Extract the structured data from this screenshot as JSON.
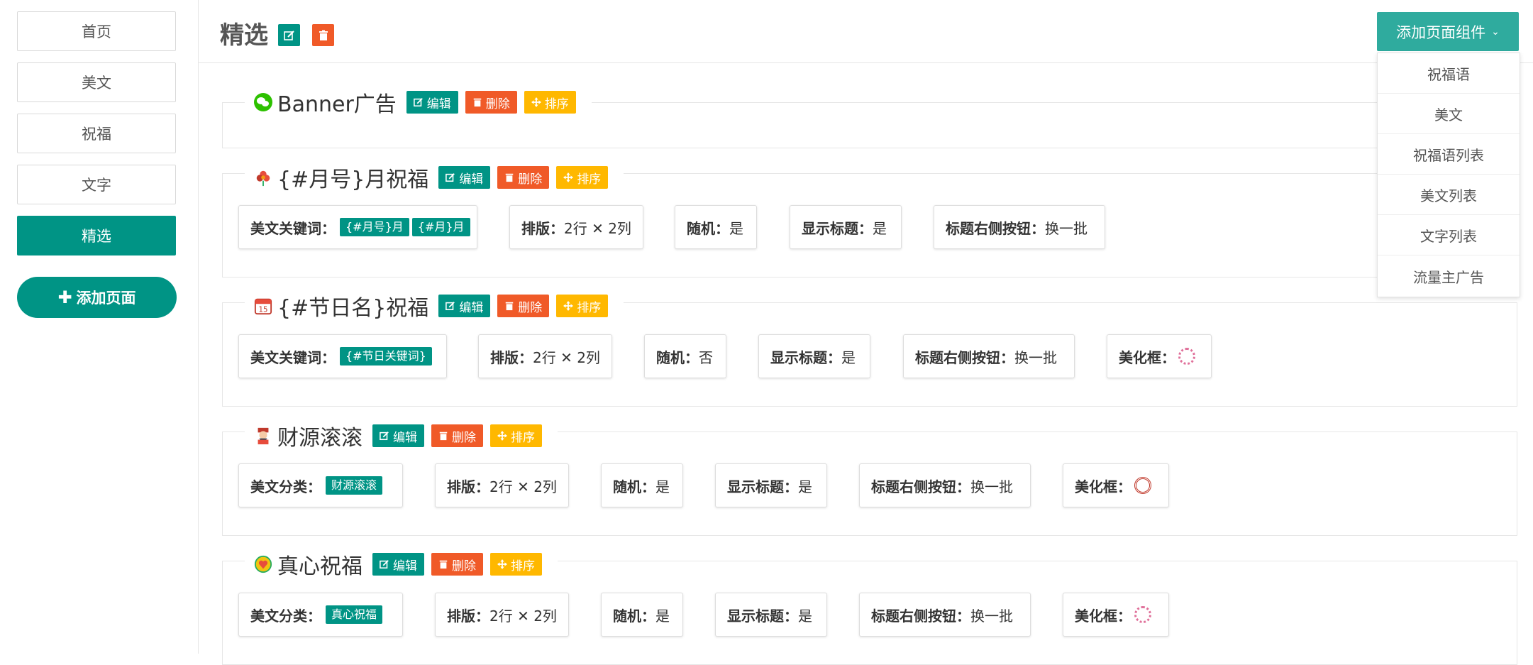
{
  "sidebar": {
    "items": [
      {
        "label": "首页"
      },
      {
        "label": "美文"
      },
      {
        "label": "祝福"
      },
      {
        "label": "文字"
      },
      {
        "label": "精选",
        "active": true
      }
    ],
    "add_page_label": "添加页面"
  },
  "header": {
    "title": "精选",
    "add_component_label": "添加页面组件"
  },
  "dropdown": {
    "items": [
      "祝福语",
      "美文",
      "祝福语列表",
      "美文列表",
      "文字列表",
      "流量主广告"
    ]
  },
  "section_buttons": {
    "edit": "编辑",
    "delete": "删除",
    "sort": "排序"
  },
  "sections": [
    {
      "title": "Banner广告",
      "icon": "wechat-icon"
    },
    {
      "title": "{#月号}月祝福",
      "icon": "flower-icon",
      "props": {
        "keyword_label": "美文关键词：",
        "keywords": [
          "{#月号}月",
          "{#月}月"
        ],
        "layout": "排版：",
        "layout_value": "2行 ✕ 2列",
        "random": "随机：",
        "random_value": "是",
        "show_title": "显示标题：",
        "show_title_value": "是",
        "right_btn": "标题右侧按钮：",
        "right_btn_value": "换一批"
      }
    },
    {
      "title": "{#节日名}祝福",
      "icon": "calendar-icon",
      "props": {
        "keyword_label": "美文关键词：",
        "keywords": [
          "{#节日关键词}"
        ],
        "layout": "排版：",
        "layout_value": "2行 ✕ 2列",
        "random": "随机：",
        "random_value": "否",
        "show_title": "显示标题：",
        "show_title_value": "是",
        "right_btn": "标题右侧按钮：",
        "right_btn_value": "换一批",
        "frame": "美化框："
      }
    },
    {
      "title": "财源滚滚",
      "icon": "fortune-god-icon",
      "props": {
        "keyword_label": "美文分类：",
        "keywords": [
          "财源滚滚"
        ],
        "layout": "排版：",
        "layout_value": "2行 ✕ 2列",
        "random": "随机：",
        "random_value": "是",
        "show_title": "显示标题：",
        "show_title_value": "是",
        "right_btn": "标题右侧按钮：",
        "right_btn_value": "换一批",
        "frame": "美化框："
      }
    },
    {
      "title": "真心祝福",
      "icon": "heart-icon",
      "props": {
        "keyword_label": "美文分类：",
        "keywords": [
          "真心祝福"
        ],
        "layout": "排版：",
        "layout_value": "2行 ✕ 2列",
        "random": "随机：",
        "random_value": "是",
        "show_title": "显示标题：",
        "show_title_value": "是",
        "right_btn": "标题右侧按钮：",
        "right_btn_value": "换一批",
        "frame": "美化框："
      }
    }
  ],
  "colors": {
    "primary": "#009485",
    "danger": "#f05a28",
    "warning": "#ffb800"
  }
}
